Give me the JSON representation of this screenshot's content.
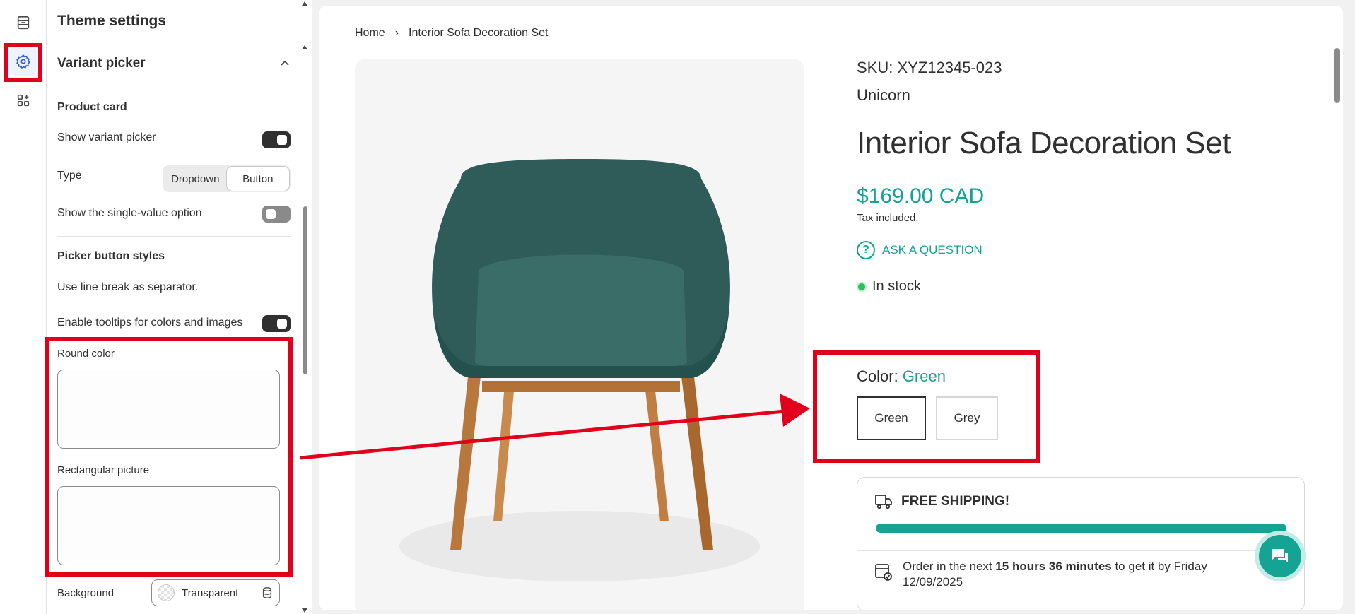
{
  "panel": {
    "title": "Theme settings",
    "section": "Variant picker",
    "product_card": "Product card",
    "show_variant_picker": "Show variant picker",
    "show_variant_picker_on": true,
    "type_label": "Type",
    "type_options": [
      "Dropdown",
      "Button"
    ],
    "type_selected": "Button",
    "single_value": "Show the single-value option",
    "single_value_on": false,
    "picker_styles": "Picker button styles",
    "line_break_note": "Use line break as separator.",
    "tooltips": "Enable tooltips for colors and images",
    "tooltips_on": true,
    "round_color": "Round color",
    "rect_picture": "Rectangular picture",
    "background_label": "Background",
    "background_value": "Transparent"
  },
  "preview": {
    "breadcrumb": [
      "Home",
      "›",
      "Interior Sofa Decoration Set"
    ],
    "sku": "SKU: XYZ12345-023",
    "vendor": "Unicorn",
    "title": "Interior Sofa Decoration Set",
    "price": "$169.00 CAD",
    "tax": "Tax included.",
    "ask": "ASK A QUESTION",
    "stock": "In stock",
    "color_label": "Color:",
    "color_value": "Green",
    "color_options": [
      "Green",
      "Grey"
    ],
    "shipping_title": "FREE SHIPPING!",
    "shipping_progress": 1.0,
    "order_prefix": "Order in the next ",
    "order_time": "15 hours 36 minutes",
    "order_suffix": " to get it by Friday 12/09/2025"
  },
  "colors": {
    "accent": "#15a394",
    "highlight": "#e0001b",
    "dark": "#303030"
  },
  "icons": [
    "sections-icon",
    "gear-icon",
    "apps-icon",
    "chevron-up-icon",
    "database-icon",
    "question-icon",
    "truck-icon",
    "calendar-check-icon",
    "chat-icon"
  ]
}
